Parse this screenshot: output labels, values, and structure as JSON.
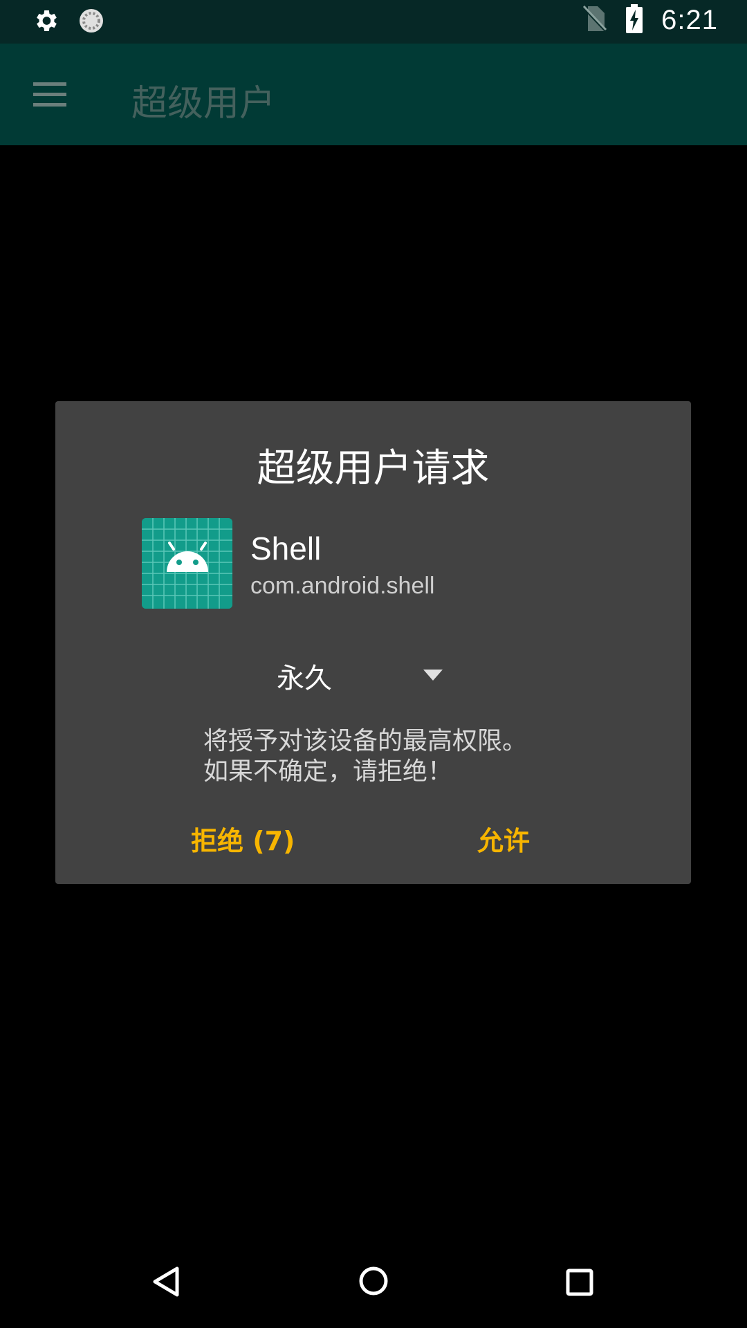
{
  "status_bar": {
    "time": "6:21",
    "icons": [
      "gear-icon",
      "sync-circle-icon",
      "no-sim-icon",
      "battery-charging-icon"
    ]
  },
  "app_bar": {
    "title": "超级用户",
    "menu_icon": "hamburger-menu-icon"
  },
  "dialog": {
    "title": "超级用户请求",
    "app_name": "Shell",
    "app_package": "com.android.shell",
    "app_icon": "android-robot-icon",
    "duration": {
      "selected": "永久"
    },
    "warning": "将授予对该设备的最高权限。\n如果不确定，请拒绝！",
    "deny_label": "拒绝 (7)",
    "allow_label": "允许"
  },
  "nav_bar": {
    "icons": [
      "back-triangle-icon",
      "home-circle-icon",
      "recents-square-icon"
    ]
  },
  "colors": {
    "status_bar": "#062826",
    "app_bar": "#013a35",
    "dialog_bg": "#424242",
    "accent": "#f7b500",
    "icon_bg": "#129c8a"
  }
}
